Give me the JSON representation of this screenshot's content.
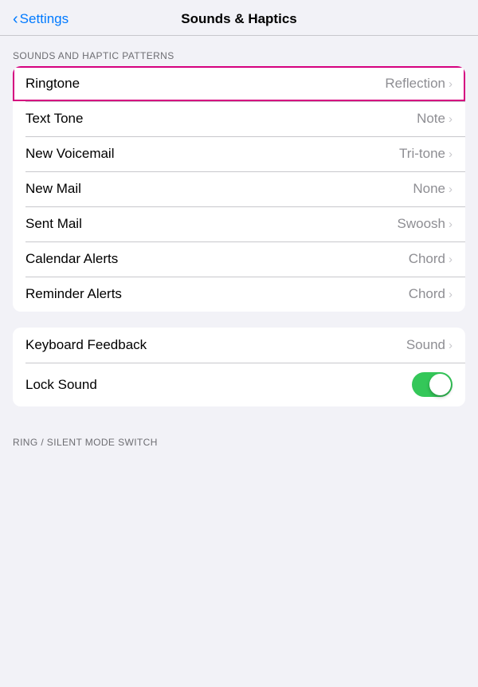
{
  "header": {
    "back_label": "Settings",
    "title": "Sounds & Haptics"
  },
  "sections": {
    "sounds_haptic": {
      "label": "SOUNDS AND HAPTIC PATTERNS",
      "rows": [
        {
          "id": "ringtone",
          "label": "Ringtone",
          "value": "Reflection",
          "highlighted": true
        },
        {
          "id": "text-tone",
          "label": "Text Tone",
          "value": "Note",
          "highlighted": false
        },
        {
          "id": "new-voicemail",
          "label": "New Voicemail",
          "value": "Tri-tone",
          "highlighted": false
        },
        {
          "id": "new-mail",
          "label": "New Mail",
          "value": "None",
          "highlighted": false
        },
        {
          "id": "sent-mail",
          "label": "Sent Mail",
          "value": "Swoosh",
          "highlighted": false
        },
        {
          "id": "calendar-alerts",
          "label": "Calendar Alerts",
          "value": "Chord",
          "highlighted": false
        },
        {
          "id": "reminder-alerts",
          "label": "Reminder Alerts",
          "value": "Chord",
          "highlighted": false
        }
      ]
    },
    "feedback": {
      "rows": [
        {
          "id": "keyboard-feedback",
          "label": "Keyboard Feedback",
          "value": "Sound",
          "type": "nav"
        },
        {
          "id": "lock-sound",
          "label": "Lock Sound",
          "value": "",
          "type": "toggle",
          "toggle_on": true
        }
      ]
    },
    "ring_silent": {
      "label": "RING / SILENT MODE SWITCH"
    }
  },
  "icons": {
    "chevron": "›",
    "back_chevron": "‹"
  }
}
